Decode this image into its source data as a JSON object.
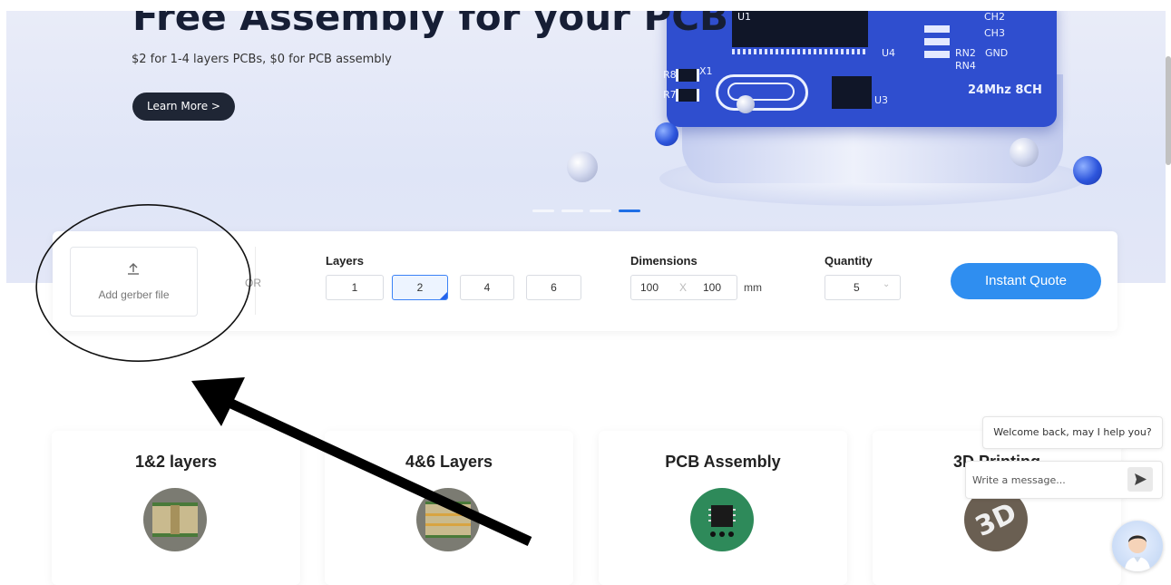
{
  "hero": {
    "title": "Free Assembly for your PCB",
    "subtitle": "$2 for 1-4 layers PCBs, $0 for PCB assembly",
    "cta_label": "Learn More >",
    "board_labels": [
      "U1",
      "U4",
      "X1",
      "R8",
      "R7",
      "U3",
      "CH2",
      "CH3",
      "RN2",
      "GND",
      "RN4"
    ],
    "board_caption": "24Mhz 8CH",
    "carousel_slides": 4,
    "carousel_active": 4
  },
  "quote": {
    "upload_label": "Add gerber file",
    "or_label": "OR",
    "layers_label": "Layers",
    "layer_options": [
      "1",
      "2",
      "4",
      "6"
    ],
    "layer_selected": "2",
    "dimensions_label": "Dimensions",
    "dim_x": "100",
    "dim_sep": "X",
    "dim_y": "100",
    "dim_unit": "mm",
    "quantity_label": "Quantity",
    "quantity_value": "5",
    "instant_quote_label": "Instant Quote"
  },
  "cards": [
    {
      "title": "1&2 layers",
      "icon": "two-layer-pcb-icon"
    },
    {
      "title": "4&6 Layers",
      "icon": "four-six-layer-pcb-icon"
    },
    {
      "title": "PCB Assembly",
      "icon": "chip-assembly-icon"
    },
    {
      "title": "3D Printing",
      "icon": "3d-printing-icon"
    }
  ],
  "chat": {
    "welcome_text": "Welcome back, may I help you?",
    "input_placeholder": "Write a message..."
  },
  "colors": {
    "accent": "#2f8ef0",
    "dark_button": "#1f2635",
    "board_blue": "#2f4ecf"
  }
}
